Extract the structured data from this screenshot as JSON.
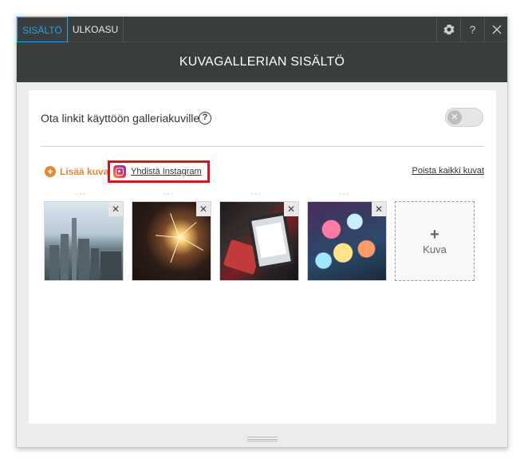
{
  "tabs": [
    {
      "label": "SISÄLTÖ",
      "active": true
    },
    {
      "label": "ULKOASU",
      "active": false
    }
  ],
  "toolbar": {
    "settings_icon": "gear-icon",
    "help_label": "?",
    "close_icon": "close-icon"
  },
  "header": {
    "title": "KUVAGALLERIAN SISÄLTÖ"
  },
  "links_setting": {
    "label": "Ota linkit käyttöön galleriakuville",
    "help": "?",
    "enabled": false,
    "toggle_icon": "x-icon",
    "toggle_glyph": "✕"
  },
  "actions": {
    "add_image": "Lisää kuva",
    "add_icon": "+",
    "connect_instagram": "Yhdistä Instagram",
    "remove_all": "Poista kaikki kuvat"
  },
  "images": [
    {
      "subject": "city-skyline",
      "remove": "✕",
      "grip": "▫▫▫"
    },
    {
      "subject": "sparkler",
      "remove": "✕",
      "grip": "▫▫▫"
    },
    {
      "subject": "tablet-and-phone",
      "remove": "✕",
      "grip": "▫▫▫"
    },
    {
      "subject": "bokeh-lights",
      "remove": "✕",
      "grip": "▫▫▫"
    }
  ],
  "add_tile": {
    "plus": "+",
    "label": "Kuva"
  },
  "colors": {
    "dark_bar": "#3a3d3d",
    "active_tab": "#2e9fe6",
    "accent_orange": "#e28a3b",
    "highlight_red": "#d3151c"
  }
}
